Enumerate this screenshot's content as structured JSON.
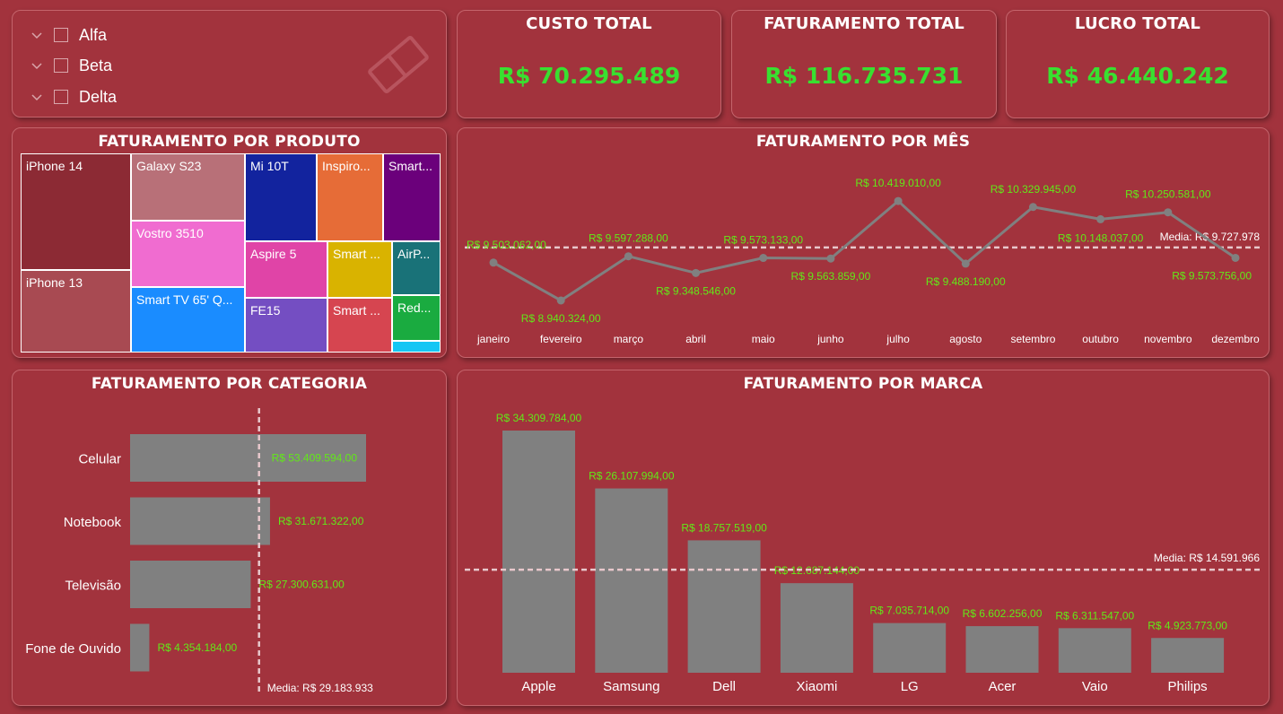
{
  "slicer": {
    "items": [
      {
        "label": "Alfa"
      },
      {
        "label": "Beta"
      },
      {
        "label": "Delta"
      }
    ]
  },
  "kpis": [
    {
      "title": "CUSTO TOTAL",
      "value": "R$ 70.295.489"
    },
    {
      "title": "FATURAMENTO TOTAL",
      "value": "R$ 116.735.731"
    },
    {
      "title": "LUCRO TOTAL",
      "value": "R$ 46.440.242"
    }
  ],
  "colors": {
    "background": "#a2333d",
    "kpi_green": "#39e030",
    "label_green": "#62e818",
    "bar_gray": "#808080"
  },
  "chart_data": [
    {
      "type": "treemap",
      "title": "FATURAMENTO POR PRODUTO",
      "cells": [
        {
          "label": "iPhone 14",
          "color": "#8c2a34"
        },
        {
          "label": "iPhone 13",
          "color": "#a84a52"
        },
        {
          "label": "Galaxy S23",
          "color": "#b87078"
        },
        {
          "label": "Vostro 3510",
          "color": "#f06cd0"
        },
        {
          "label": "Smart TV 65' Q...",
          "color": "#1a8cff"
        },
        {
          "label": "Mi 10T",
          "color": "#12239e"
        },
        {
          "label": "Inspiro...",
          "color": "#e66c37"
        },
        {
          "label": "Smart...",
          "color": "#6b007b"
        },
        {
          "label": "Aspire 5",
          "color": "#e044a7"
        },
        {
          "label": "Smart ...",
          "color": "#d9b300"
        },
        {
          "label": "AirP...",
          "color": "#197278"
        },
        {
          "label": "FE15",
          "color": "#744ec2"
        },
        {
          "label": "Smart ...",
          "color": "#d64550"
        },
        {
          "label": "Red...",
          "color": "#1aab40"
        },
        {
          "label": "",
          "color": "#15c6f4"
        }
      ]
    },
    {
      "type": "line",
      "title": "FATURAMENTO POR MÊS",
      "categories": [
        "janeiro",
        "fevereiro",
        "março",
        "abril",
        "maio",
        "junho",
        "julho",
        "agosto",
        "setembro",
        "outubro",
        "novembro",
        "dezembro"
      ],
      "values": [
        9503062,
        8940324,
        9597288,
        9348546,
        9573133,
        9563859,
        10419010,
        9488190,
        10329945,
        10148037,
        10250581,
        9573756
      ],
      "labels": [
        "R$ 9.503.062,00",
        "R$ 8.940.324,00",
        "R$ 9.597.288,00",
        "R$ 9.348.546,00",
        "R$ 9.573.133,00",
        "R$ 9.563.859,00",
        "R$ 10.419.010,00",
        "R$ 9.488.190,00",
        "R$ 10.329.945,00",
        "R$ 10.148.037,00",
        "R$ 10.250.581,00",
        "R$ 9.573.756,00"
      ],
      "average": 9727978,
      "average_label": "Media: R$ 9.727.978",
      "ylim": [
        8700000,
        10700000
      ]
    },
    {
      "type": "bar",
      "orientation": "horizontal",
      "title": "FATURAMENTO POR CATEGORIA",
      "categories": [
        "Celular",
        "Notebook",
        "Televisão",
        "Fone de Ouvido"
      ],
      "values": [
        53409594,
        31671322,
        27300631,
        4354184
      ],
      "labels": [
        "R$ 53.409.594,00",
        "R$ 31.671.322,00",
        "R$ 27.300.631,00",
        "R$ 4.354.184,00"
      ],
      "average": 29183933,
      "average_label": "Media: R$ 29.183.933",
      "xlim": [
        0,
        53409594
      ]
    },
    {
      "type": "bar",
      "orientation": "vertical",
      "title": "FATURAMENTO POR MARCA",
      "categories": [
        "Apple",
        "Samsung",
        "Dell",
        "Xiaomi",
        "LG",
        "Acer",
        "Vaio",
        "Philips"
      ],
      "values": [
        34309784,
        26107994,
        18757519,
        12687144,
        7035714,
        6602256,
        6311547,
        4923773
      ],
      "labels": [
        "R$ 34.309.784,00",
        "R$ 26.107.994,00",
        "R$ 18.757.519,00",
        "R$ 12.687.144,00",
        "R$ 7.035.714,00",
        "R$ 6.602.256,00",
        "R$ 6.311.547,00",
        "R$ 4.923.773,00"
      ],
      "average": 14591966,
      "average_label": "Media: R$ 14.591.966",
      "ylim": [
        0,
        34309784
      ]
    }
  ]
}
